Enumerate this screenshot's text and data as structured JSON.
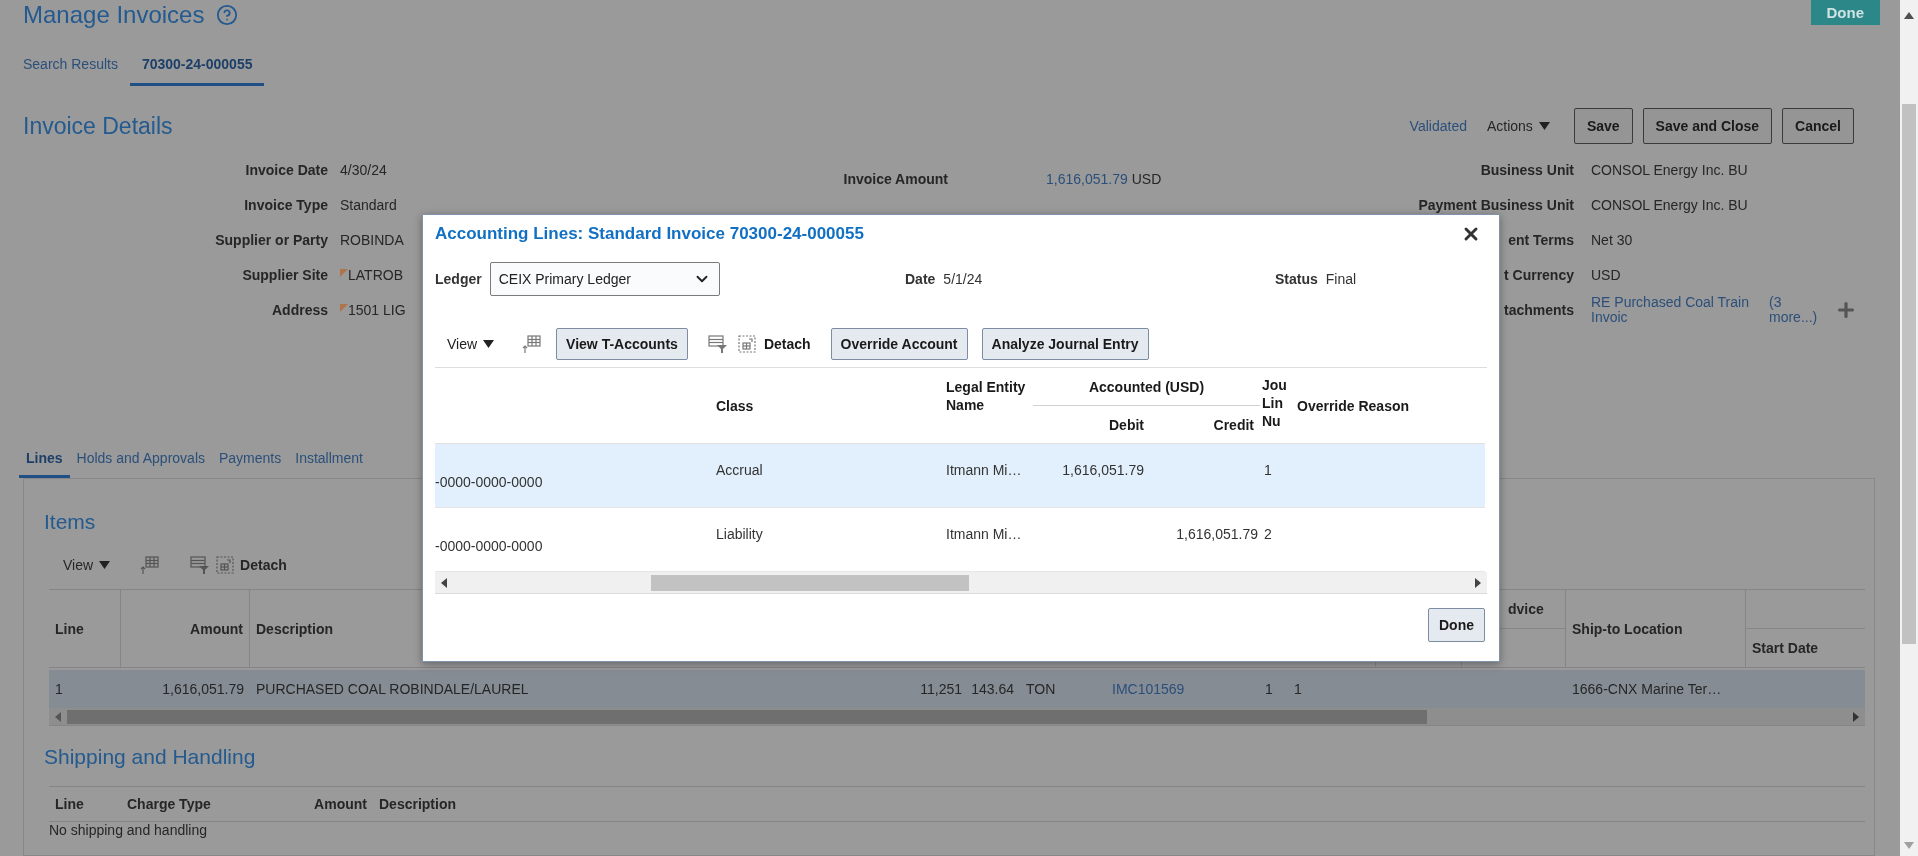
{
  "page": {
    "title": "Manage Invoices",
    "done_button": "Done"
  },
  "tabs": [
    {
      "label": "Search Results",
      "selected": false
    },
    {
      "label": "70300-24-000055",
      "selected": true
    }
  ],
  "invoice_details": {
    "title": "Invoice Details",
    "status": "Validated",
    "actions": "Actions",
    "buttons": [
      "Save",
      "Save and Close",
      "Cancel"
    ],
    "left_fields": [
      {
        "label": "Invoice Date",
        "value": "4/30/24",
        "flagged": false
      },
      {
        "label": "Invoice Type",
        "value": "Standard",
        "flagged": false
      },
      {
        "label": "Supplier or Party",
        "value": "ROBINDA",
        "flagged": false
      },
      {
        "label": "Supplier Site",
        "value": "LATROB",
        "flagged": true
      },
      {
        "label": "Address",
        "value": "1501 LIG",
        "flagged": true
      }
    ],
    "amount_field": {
      "label": "Invoice Amount",
      "amount": "1,616,051.79",
      "currency": "USD"
    },
    "right_fields": [
      {
        "kind": "text",
        "label": "Business Unit",
        "value": "CONSOL Energy Inc. BU"
      },
      {
        "kind": "text",
        "label": "Payment Business Unit",
        "value": "CONSOL Energy Inc. BU"
      },
      {
        "kind": "text",
        "label": "ent Terms",
        "value": "Net 30"
      },
      {
        "kind": "text",
        "label": "t Currency",
        "value": "USD"
      },
      {
        "kind": "attachments",
        "label": "tachments",
        "value": "RE Purchased Coal Train Invoic",
        "more": "(3 more...)"
      }
    ]
  },
  "lower_tabs": [
    {
      "label": "Lines",
      "selected": true
    },
    {
      "label": "Holds and Approvals",
      "selected": false
    },
    {
      "label": "Payments",
      "selected": false
    },
    {
      "label": "Installment",
      "selected": false
    }
  ],
  "items": {
    "title": "Items",
    "view_menu": "View",
    "detach": "Detach",
    "columns": {
      "line": "Line",
      "amount": "Amount",
      "description": "Description",
      "column_12": "dvice",
      "ship_to_location": "Ship-to Location",
      "start_date": "Start Date"
    },
    "rows": [
      {
        "selected": true,
        "line": "1",
        "amount": "1,616,051.79",
        "description": "PURCHASED COAL ROBINDALE/LAUREL",
        "column_4": "11,251",
        "column_5": "143.64",
        "column_6": "TON",
        "column_7": "IMC101569",
        "column_8": "1",
        "column_9": "1",
        "ship_to_location": "1666-CNX Marine Ter…"
      }
    ]
  },
  "shipping": {
    "title": "Shipping and Handling",
    "columns": [
      "Line",
      "Charge Type",
      "Amount",
      "Description"
    ],
    "empty_message": "No shipping and handling"
  },
  "dialog": {
    "title": "Accounting Lines: Standard Invoice 70300-24-000055",
    "ledger": {
      "label": "Ledger",
      "value": "CEIX Primary Ledger"
    },
    "date": {
      "label": "Date",
      "value": "5/1/24"
    },
    "status": {
      "label": "Status",
      "value": "Final"
    },
    "toolbar": {
      "view_menu": "View",
      "detach": "Detach",
      "buttons": [
        "View T-Accounts",
        "Override Account",
        "Analyze Journal Entry"
      ]
    },
    "headers": {
      "class": "Class",
      "legal_entity": "Legal Entity Name",
      "accounted": "Accounted (USD)",
      "debit": "Debit",
      "credit": "Credit",
      "line_number": "Jou Lin Nu",
      "override_reason": "Override Reason"
    },
    "rows": [
      {
        "selected": true,
        "account": "-0000-0000-0000",
        "class": "Accrual",
        "legal_entity": "Itmann Mi…",
        "debit": "1,616,051.79",
        "line_number": "1"
      },
      {
        "selected": false,
        "account": "-0000-0000-0000",
        "class": "Liability",
        "legal_entity": "Itmann Mi…",
        "credit": "1,616,051.79",
        "line_number": "2"
      }
    ],
    "done_button": "Done"
  }
}
